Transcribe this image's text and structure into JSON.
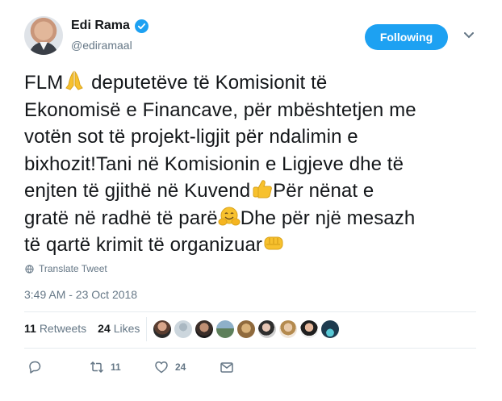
{
  "user": {
    "display_name": "Edi Rama",
    "handle": "@ediramaal",
    "verified_icon": "verified-badge-icon"
  },
  "header": {
    "follow_label": "Following",
    "caret_icon": "chevron-down-icon"
  },
  "tweet": {
    "line1_a": "FLM",
    "line1_b": " deputetëve të Komisionit të",
    "line2": "Ekonomisë e Financave, për mbështetjen me",
    "line3": "votën sot të projekt-ligjit për ndalimin e",
    "line4": "bixhozit!Tani në Komisionin e Ligjeve dhe të",
    "line5_a": "enjten të gjithë në Kuvend",
    "line5_b": "Për nënat e",
    "line6_a": "gratë në radhë të parë",
    "line6_b": "Dhe për një mesazh",
    "line7": "të qartë krimit të organizuar",
    "emojis": [
      "folded-hands-emoji",
      "thumbs-up-emoji",
      "hugging-face-emoji",
      "oncoming-fist-emoji"
    ]
  },
  "translate_label": "Translate Tweet",
  "timestamp": "3:49 AM - 23 Oct 2018",
  "stats": {
    "retweets_count": "11",
    "retweets_label": "Retweets",
    "likes_count": "24",
    "likes_label": "Likes"
  },
  "actions": {
    "reply_icon": "reply-icon",
    "retweet_icon": "retweet-icon",
    "retweet_count": "11",
    "like_icon": "heart-icon",
    "like_count": "24",
    "dm_icon": "envelope-icon"
  },
  "colors": {
    "accent": "#1da1f2",
    "text": "#14171a",
    "muted": "#657786",
    "emoji_yellow": "#f7c12e"
  }
}
